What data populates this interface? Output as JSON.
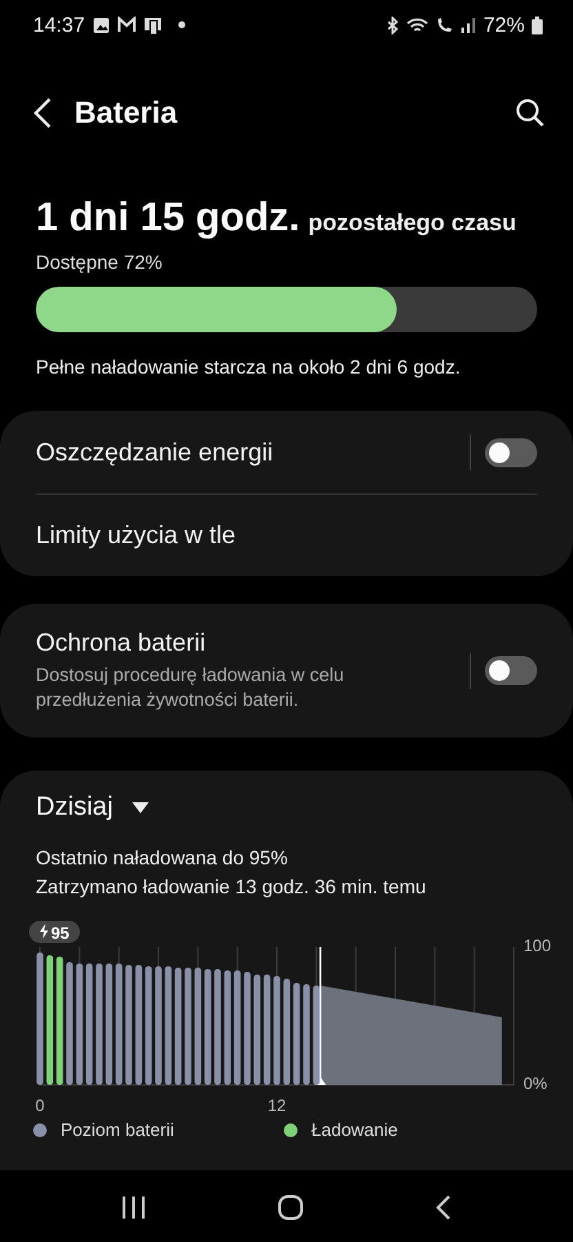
{
  "status_bar": {
    "time": "14:37",
    "battery": "72%"
  },
  "header": {
    "title": "Bateria"
  },
  "summary": {
    "remaining": "1 dni 15 godz.",
    "remaining_suffix": "pozostałego czasu",
    "available": "Dostępne 72%",
    "level": 0.72,
    "full_charge": "Pełne naładowanie starcza na około 2 dni 6 godz."
  },
  "settings_groups": [
    {
      "items": [
        {
          "kind": "toggle",
          "label": "Oszczędzanie energii",
          "on": false
        },
        {
          "kind": "link",
          "label": "Limity użycia w tle"
        }
      ]
    },
    {
      "items": [
        {
          "kind": "toggle",
          "label": "Ochrona baterii",
          "description": "Dostosuj procedurę ładowania w celu przedłużenia żywotności baterii.",
          "on": false
        }
      ]
    }
  ],
  "usage": {
    "period": "Dzisiaj",
    "last_charged": "Ostatnio naładowana do 95%",
    "stopped": "Zatrzymano ładowanie 13 godz. 36 min. temu",
    "peak_badge": "95",
    "chart_data": {
      "type": "bar",
      "x": [
        0,
        0.5,
        1,
        1.5,
        2,
        2.5,
        3,
        3.5,
        4,
        4.5,
        5,
        5.5,
        6,
        6.5,
        7,
        7.5,
        8,
        8.5,
        9,
        9.5,
        10,
        10.5,
        11,
        11.5,
        12,
        12.5,
        13,
        13.5,
        14
      ],
      "series": [
        {
          "name": "Poziom baterii",
          "color": "#8a90a8",
          "values": [
            96,
            null,
            null,
            89,
            88,
            88,
            88,
            88,
            88,
            87,
            87,
            86,
            86,
            86,
            85,
            85,
            85,
            84,
            84,
            83,
            83,
            82,
            80,
            80,
            79,
            77,
            74,
            73,
            72
          ]
        },
        {
          "name": "Ładowanie",
          "color": "#7fd17a",
          "values": [
            null,
            94,
            93,
            null,
            null,
            null,
            null,
            null,
            null,
            null,
            null,
            null,
            null,
            null,
            null,
            null,
            null,
            null,
            null,
            null,
            null,
            null,
            null,
            null,
            null,
            null,
            null,
            null,
            null
          ]
        }
      ],
      "stacked": true,
      "ref_lines": [
        {
          "axis": "x",
          "value": 14.2
        }
      ],
      "xlim": [
        0,
        24
      ],
      "ylim": [
        0,
        100
      ],
      "xticks": [
        0,
        12
      ],
      "yticks": [
        {
          "value": 0,
          "label": "0%"
        },
        {
          "value": 100,
          "label": "100"
        }
      ]
    }
  }
}
